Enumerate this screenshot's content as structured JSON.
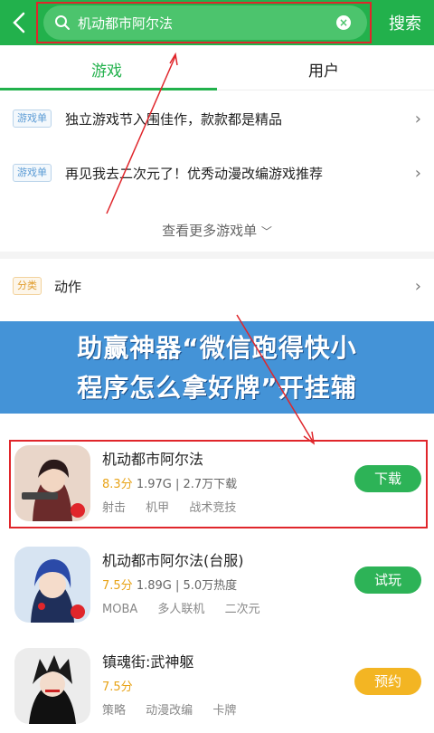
{
  "header": {
    "search_query": "机动都市阿尔法",
    "search_button": "搜索"
  },
  "tabs": [
    {
      "label": "游戏",
      "active": true
    },
    {
      "label": "用户",
      "active": false
    }
  ],
  "lists": [
    {
      "tag": "游戏单",
      "text": "独立游戏节入围佳作，款款都是精品"
    },
    {
      "tag": "游戏单",
      "text": "再见我去二次元了！优秀动漫改编游戏推荐"
    }
  ],
  "more_lists": "查看更多游戏单",
  "categories": [
    {
      "tag": "分类",
      "text": "动作"
    },
    {
      "tag": "分类",
      "text": ""
    }
  ],
  "banner": {
    "line1": "助赢神器“微信跑得快小",
    "line2": "程序怎么拿好牌”开挂辅"
  },
  "apps": [
    {
      "name": "机动都市阿尔法",
      "score": "8.3分",
      "info": " 1.97G | 2.7万下载",
      "tags": [
        "射击",
        "机甲",
        "战术竞技"
      ],
      "action": "下载",
      "action_color": "#2db357"
    },
    {
      "name": "机动都市阿尔法(台服)",
      "score": "7.5分",
      "info": " 1.89G | 5.0万热度",
      "tags": [
        "MOBA",
        "多人联机",
        "二次元"
      ],
      "action": "试玩",
      "action_color": "#2db357"
    },
    {
      "name": "镇魂街:武神躯",
      "score": "7.5分",
      "info": "",
      "tags": [
        "策略",
        "动漫改编",
        "卡牌"
      ],
      "action": "预约",
      "action_color": "#f3b523"
    }
  ],
  "colors": {
    "brand": "#22b14c",
    "highlight": "#e0262b",
    "banner": "#2a84d2"
  }
}
